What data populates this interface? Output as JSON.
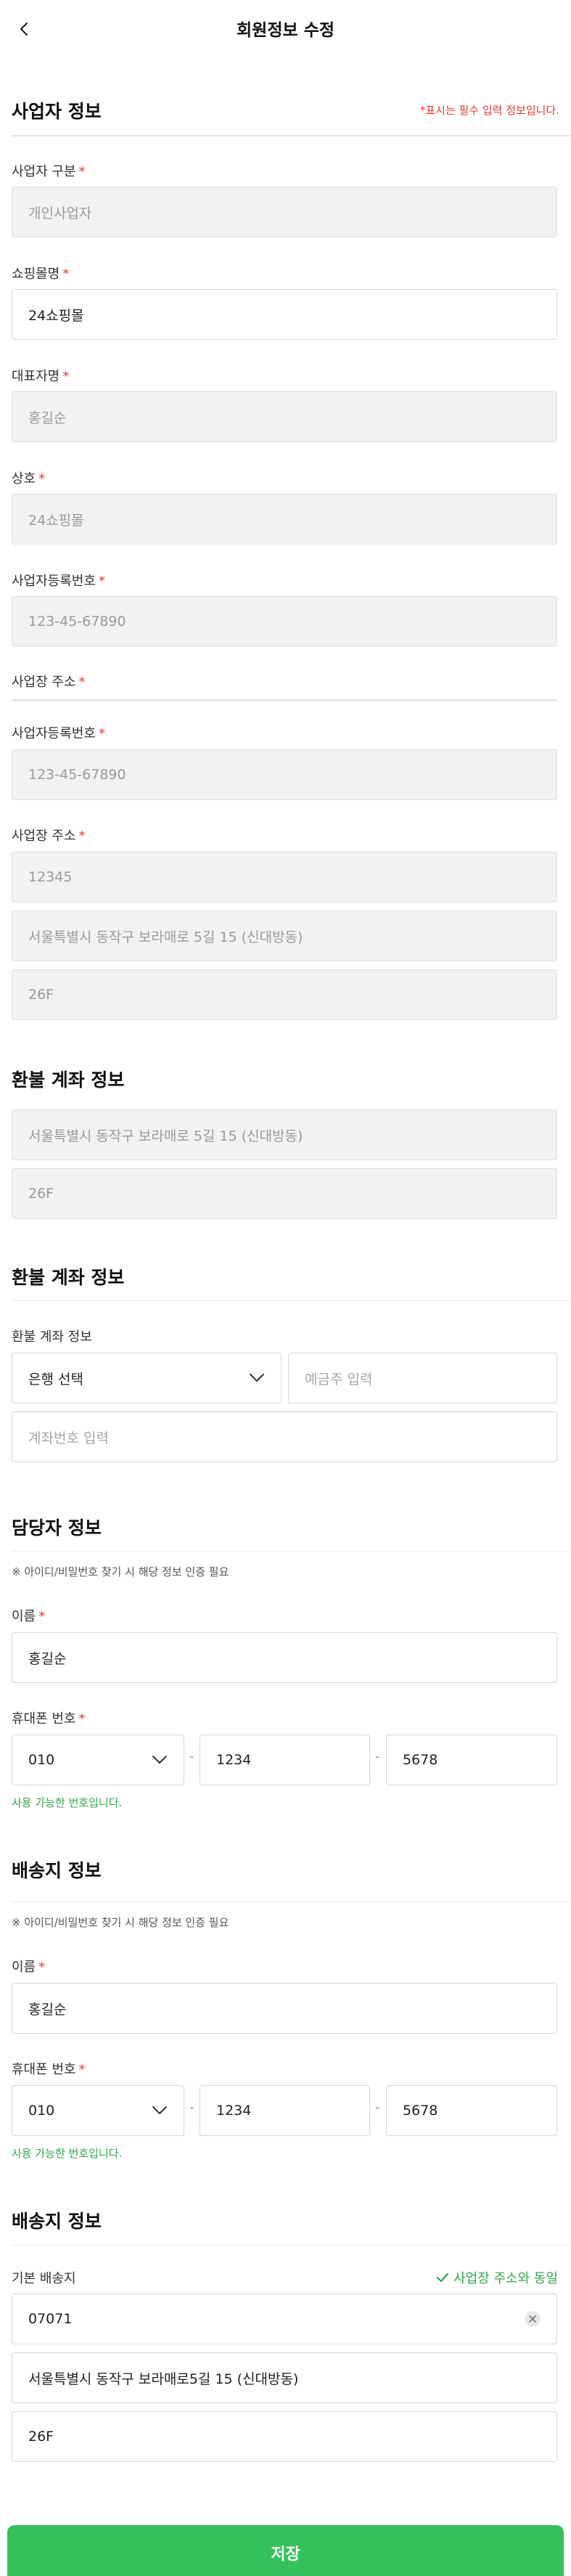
{
  "header": {
    "title": "회원정보 수정"
  },
  "business": {
    "title": "사업자 정보",
    "required_note": "*표시는 필수 입력 정보입니다.",
    "type_label": "사업자 구분",
    "type_value": "개인사업자",
    "mall_label": "쇼핑몰명",
    "mall_value": "24쇼핑몰",
    "rep_label": "대표자명",
    "rep_value": "홍길순",
    "company_label": "상호",
    "company_value": "24쇼핑몰",
    "regno_label": "사업자등록번호",
    "regno_value": "123-45-67890",
    "addr_label": "사업장 주소",
    "regno2_label": "사업자등록번호",
    "regno2_value": "123-45-67890",
    "addr2_label": "사업장 주소",
    "zip": "12345",
    "addr_line1": "서울특별시 동작구 보라매로 5길 15 (신대방동)",
    "addr_line2": "26F"
  },
  "refund1": {
    "title": "환불 계좌 정보",
    "addr_line1": "서울특별시 동작구 보라매로 5길 15 (신대방동)",
    "addr_line2": "26F"
  },
  "refund2": {
    "title": "환불 계좌 정보",
    "label": "환불 계좌 정보",
    "bank_select": "은행 선택",
    "holder_placeholder": "예금주 입력",
    "account_placeholder": "계좌번호 입력"
  },
  "manager": {
    "title": "담당자 정보",
    "notice": "※ 아이디/비밀번호 찾기 시 해당 정보 인증 필요",
    "name_label": "이름",
    "name_value": "홍길순",
    "phone_label": "휴대폰 번호",
    "phone_prefix": "010",
    "phone_mid": "1234",
    "phone_last": "5678",
    "dash": "-",
    "ok_msg": "사용 가능한 번호입니다."
  },
  "shipping1": {
    "title": "배송지 정보",
    "notice": "※ 아이디/비밀번호 찾기 시 해당 정보 인증 필요",
    "name_label": "이름",
    "name_value": "홍길순",
    "phone_label": "휴대폰 번호",
    "phone_prefix": "010",
    "phone_mid": "1234",
    "phone_last": "5678",
    "dash": "-",
    "ok_msg": "사용 가능한 번호입니다."
  },
  "shipping2": {
    "title": "배송지 정보",
    "default_label": "기본 배송지",
    "same_addr_label": "사업장 주소와 동일",
    "zip": "07071",
    "addr_line1": "서울특별시 동작구 보라매로5길 15 (신대방동)",
    "addr_line2": "26F"
  },
  "footer": {
    "save_label": "저장"
  },
  "colors": {
    "accent": "#35c25b",
    "required": "#e53935",
    "success": "#2fa84f",
    "disabled_bg": "#f2f2f2"
  },
  "icons": {
    "back": "chevron-left-icon",
    "dropdown": "chevron-down-icon",
    "check": "check-icon",
    "clear": "close-icon"
  }
}
